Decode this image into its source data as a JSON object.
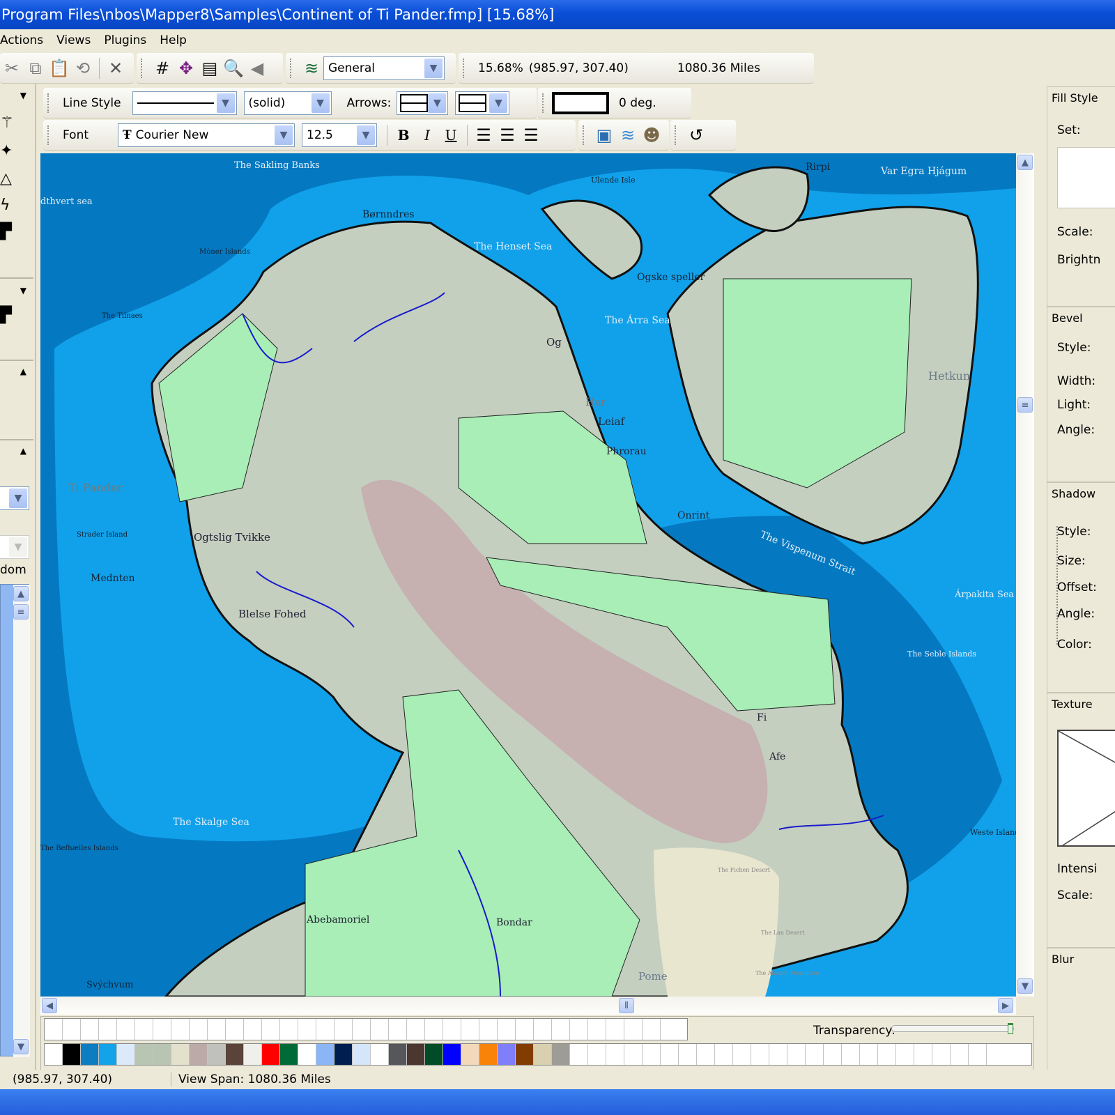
{
  "window": {
    "title": "Program Files\\nbos\\Mapper8\\Samples\\Continent of Ti Pander.fmp] [15.68%]"
  },
  "menu": {
    "items": [
      "Actions",
      "Views",
      "Plugins",
      "Help"
    ]
  },
  "toolbar_main": {
    "icons": [
      "cut-icon",
      "copy-icon",
      "paste-icon",
      "undo-icon",
      "delete-icon",
      "grid-icon",
      "move-icon",
      "properties-icon",
      "zoom-icon",
      "back-icon"
    ],
    "layer_select": "General",
    "zoom_readout": "15.68%",
    "coordinates": "(985.97, 307.40)",
    "view_distance": "1080.36 Miles"
  },
  "toolbar_line": {
    "line_style_label": "Line Style",
    "line_pattern": "(solid)",
    "arrows_label": "Arrows:",
    "angle": "0 deg."
  },
  "toolbar_font": {
    "font_label": "Font",
    "font_name": "Courier New",
    "font_size": "12.5",
    "bold": "B",
    "italic": "I",
    "underline": "U"
  },
  "left_panel": {
    "partial_label": "dom"
  },
  "right_panel": {
    "fill": {
      "header": "Fill Style",
      "set": "Set:",
      "scale": "Scale:",
      "brightness": "Brightn"
    },
    "bevel": {
      "header": "Bevel",
      "style": "Style:",
      "width": "Width:",
      "light": "Light:",
      "angle": "Angle:"
    },
    "shadow": {
      "header": "Shadow",
      "style": "Style:",
      "size": "Size:",
      "offset": "Offset:",
      "angle": "Angle:",
      "color": "Color:"
    },
    "texture": {
      "header": "Texture",
      "intensity": "Intensi",
      "scale": "Scale:"
    },
    "blur": {
      "header": "Blur"
    }
  },
  "palette": {
    "transparency_label": "Transparency:",
    "transparency_value": 1.0,
    "colors": [
      "#ffffff",
      "#000000",
      "#0b7dc0",
      "#12a3e9",
      "#dbe9f8",
      "#b7c5b2",
      "#b7c5b2",
      "#e3e1cc",
      "#bcaaa8",
      "#c0c0bd",
      "#5a4338",
      "#efefec",
      "#ff0000",
      "#006b37",
      "#ffffff",
      "#8ab6f5",
      "#001e4f",
      "#d6e6fa",
      "#ffffff",
      "#55575a",
      "#4b3730",
      "#004c27",
      "#0000ff",
      "#f3d8b9",
      "#f98208",
      "#7f7ffc",
      "#833c00",
      "#d9d0b0",
      "#9d9c97"
    ]
  },
  "status": {
    "coords": "(985.97, 307.40)",
    "view_span": "View Span: 1080.36 Miles"
  },
  "map": {
    "seas": [
      "The Sakling Banks",
      "dthvert sea",
      "The Henset Sea",
      "The Árra Sea",
      "Var Egra Hjágum",
      "The Tilnaes",
      "The Vispenum Strait",
      "Árpakita Sea",
      "The Seble Islands",
      "The Skalge Sea",
      "The Befhælles Islands",
      "Mednten"
    ],
    "regions": [
      "Børnndres",
      "Ti Pander",
      "Ogtslig Tvikke",
      "Blelse Fohed",
      "Abebamoriel",
      "Bondar",
      "Hetkun",
      "Rirpi",
      "Ogske speller",
      "Ulende Isle",
      "Mòner Islands",
      "Strader Island",
      "Weste Island",
      "The Fichen Desert",
      "The Lan Desert",
      "The Afaneri Mountains"
    ],
    "cities": [
      "Og",
      "Har",
      "Leiaf",
      "Phrorau",
      "Onrint",
      "Fi",
      "Afe",
      "Pome",
      "Svýchvum"
    ]
  },
  "colors": {
    "deep_sea": "#0479c2",
    "shallow_sea": "#11a1ea",
    "land": "#c4cfc0",
    "forest": "#a8eeb6",
    "mountain": "#c6b0b0",
    "desert": "#e8e6cf",
    "river": "#1a1acc"
  }
}
